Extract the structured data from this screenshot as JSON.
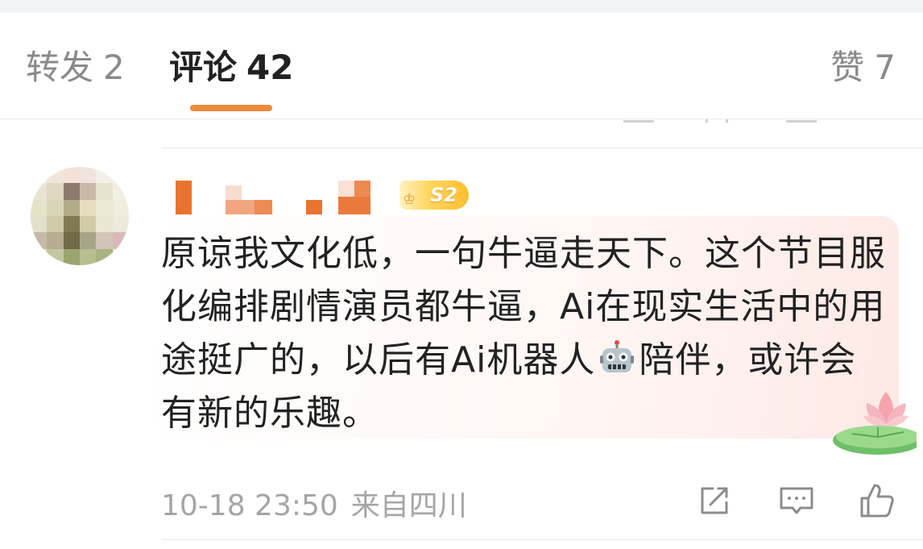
{
  "tabs": {
    "repost": {
      "label": "转发",
      "count": "2"
    },
    "comments": {
      "label": "评论",
      "count": "42"
    },
    "likes": {
      "label": "赞",
      "count": "7"
    },
    "active": "comments",
    "accent_color": "#ee8a39"
  },
  "comment": {
    "level_badge": "S2",
    "text_part1": "原谅我文化低，一句牛逼走天下。这个节目服化编排剧情演员都牛逼，Ai在现实生活中的用途挺广的，以后有Ai机器人",
    "emoji_icon": "robot-icon",
    "text_part2": "陪伴，或许会有新的乐趣。",
    "timestamp": "10-18 23:50",
    "source": "来自四川",
    "decoration_icon": "lotus-icon"
  },
  "actions": {
    "share_icon": "share-icon",
    "reply_icon": "reply-icon",
    "like_icon": "thumbs-up-icon"
  }
}
